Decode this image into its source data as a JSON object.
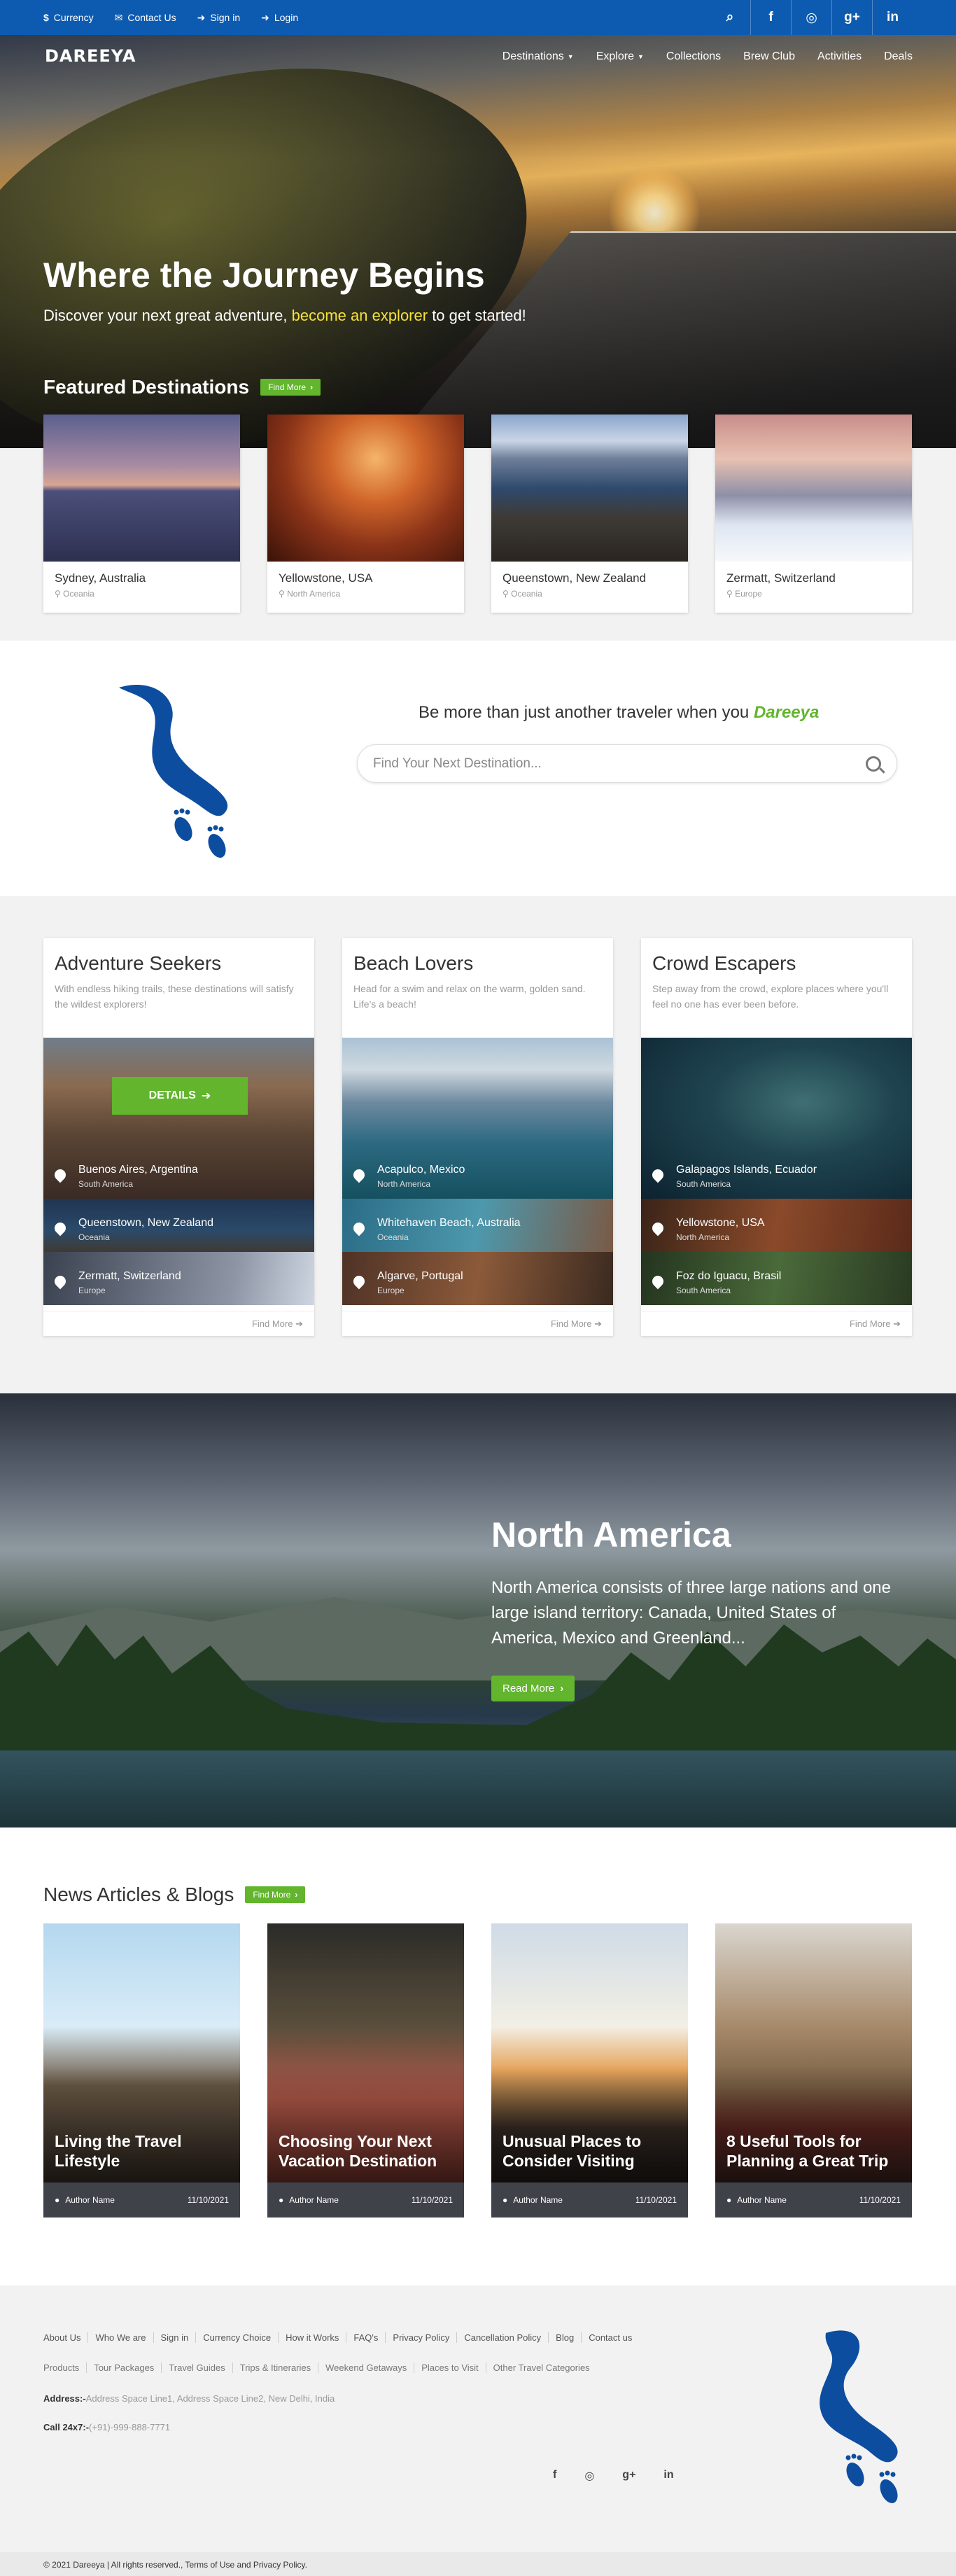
{
  "topbar": {
    "links": [
      {
        "icon": "dollar-icon",
        "glyph": "$",
        "label": "Currency"
      },
      {
        "icon": "mail-icon",
        "glyph": "✉",
        "label": "Contact Us"
      },
      {
        "icon": "sign-in-icon",
        "glyph": "➜",
        "label": "Sign in"
      },
      {
        "icon": "login-icon",
        "glyph": "➜",
        "label": "Login"
      }
    ],
    "social": [
      {
        "icon": "search-icon",
        "glyph": "⌕"
      },
      {
        "icon": "facebook-icon",
        "glyph": "f"
      },
      {
        "icon": "instagram-icon",
        "glyph": "◎"
      },
      {
        "icon": "google-plus-icon",
        "glyph": "g+"
      },
      {
        "icon": "linkedin-icon",
        "glyph": "in"
      }
    ]
  },
  "brand": {
    "logo": "DAREEYA"
  },
  "nav": {
    "items": [
      {
        "label": "Destinations",
        "caret": "▼"
      },
      {
        "label": "Explore",
        "caret": "▼"
      },
      {
        "label": "Collections",
        "caret": ""
      },
      {
        "label": "Brew Club",
        "caret": ""
      },
      {
        "label": "Activities",
        "caret": ""
      },
      {
        "label": "Deals",
        "caret": ""
      }
    ]
  },
  "hero": {
    "title": "Where the Journey Begins",
    "sub_before": "Discover your next great adventure, ",
    "sub_link": "become an explorer",
    "sub_after": " to get started!"
  },
  "featured": {
    "title": "Featured Destinations",
    "button": "Find More",
    "cards": [
      {
        "name": "Sydney, Australia",
        "region": "Oceania"
      },
      {
        "name": "Yellowstone, USA",
        "region": "North America"
      },
      {
        "name": "Queenstown, New Zealand",
        "region": "Oceania"
      },
      {
        "name": "Zermatt, Switzerland",
        "region": "Europe"
      }
    ]
  },
  "tagline": {
    "text": "Be more than just another traveler when you ",
    "brand": "Dareeya"
  },
  "search": {
    "placeholder": "Find Your Next Destination..."
  },
  "categories": [
    {
      "title": "Adventure Seekers",
      "desc": "With endless hiking trails, these destinations will satisfy the wildest explorers!",
      "details": "DETAILS",
      "places": [
        {
          "name": "Buenos Aires, Argentina",
          "region": "South America"
        },
        {
          "name": "Queenstown, New Zealand",
          "region": "Oceania"
        },
        {
          "name": "Zermatt, Switzerland",
          "region": "Europe"
        }
      ],
      "more": "Find More"
    },
    {
      "title": "Beach Lovers",
      "desc": "Head for a swim and relax on the warm, golden sand. Life's a beach!",
      "places": [
        {
          "name": "Acapulco, Mexico",
          "region": "North America"
        },
        {
          "name": "Whitehaven Beach, Australia",
          "region": "Oceania"
        },
        {
          "name": "Algarve, Portugal",
          "region": "Europe"
        }
      ],
      "more": "Find More"
    },
    {
      "title": "Crowd Escapers",
      "desc": "Step away from the crowd, explore places where you'll feel no one has ever been before.",
      "places": [
        {
          "name": "Galapagos Islands, Ecuador",
          "region": "South America"
        },
        {
          "name": "Yellowstone, USA",
          "region": "North America"
        },
        {
          "name": "Foz do Iguacu, Brasil",
          "region": "South America"
        }
      ],
      "more": "Find More"
    }
  ],
  "north_america": {
    "title": "North America",
    "text": "North America consists of three large nations and one large island territory: Canada, United States of America, Mexico and Greenland...",
    "button": "Read More"
  },
  "news": {
    "title": "News Articles & Blogs",
    "button": "Find More",
    "articles": [
      {
        "title": "Living the Travel Lifestyle",
        "author": "Author Name",
        "date": "11/10/2021"
      },
      {
        "title": "Choosing Your Next Vacation Destination",
        "author": "Author Name",
        "date": "11/10/2021"
      },
      {
        "title": "Unusual Places to Consider Visiting",
        "author": "Author Name",
        "date": "11/10/2021"
      },
      {
        "title": "8 Useful Tools for Planning a Great Trip",
        "author": "Author Name",
        "date": "11/10/2021"
      }
    ]
  },
  "footer": {
    "links_row1": [
      "About Us",
      "Who We are",
      "Sign in",
      "Currency Choice",
      "How it Works",
      "FAQ's",
      "Privacy Policy",
      "Cancellation Policy",
      "Blog",
      "Contact us"
    ],
    "links_row2": [
      "Products",
      "Tour Packages",
      "Travel Guides",
      "Trips & Itineraries",
      "Weekend Getaways",
      "Places to Visit",
      "Other Travel Categories"
    ],
    "address_label": "Address:-",
    "address": "Address Space Line1, Address Space Line2, New Delhi, India",
    "call_label": "Call 24x7:-",
    "call": "(+91)-999-888-7771",
    "social": [
      {
        "icon": "facebook-icon",
        "glyph": "f"
      },
      {
        "icon": "instagram-icon",
        "glyph": "◎"
      },
      {
        "icon": "google-plus-icon",
        "glyph": "g+"
      },
      {
        "icon": "linkedin-icon",
        "glyph": "in"
      }
    ],
    "copyright": "© 2021 Dareeya | All rights reserved., Terms of Use and Privacy Policy."
  },
  "colors": {
    "topbar": "#0d5bb0",
    "accent_green": "#62b52d",
    "highlight_yellow": "#f5e23a",
    "logo_blue": "#0d4da0"
  }
}
